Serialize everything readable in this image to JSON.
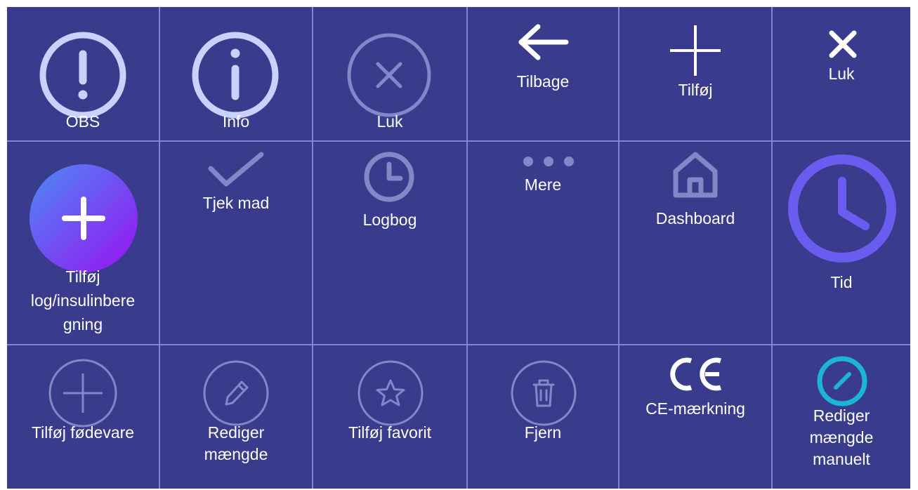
{
  "icons": [
    {
      "label": "OBS",
      "icon": "alert-circle-icon"
    },
    {
      "label": "Info",
      "icon": "info-circle-icon"
    },
    {
      "label": "Luk",
      "icon": "close-circle-icon"
    },
    {
      "label": "Tilbage",
      "icon": "arrow-left-icon"
    },
    {
      "label": "Tilføj",
      "icon": "plus-icon"
    },
    {
      "label": "Luk",
      "icon": "close-icon"
    },
    {
      "label": "Tilføj log/insulinberegning",
      "label_lines": [
        "Tilføj",
        "log/insulinbere",
        "gning"
      ],
      "icon": "add-log-gradient-icon"
    },
    {
      "label": "Tjek mad",
      "icon": "check-icon"
    },
    {
      "label": "Logbog",
      "icon": "clock-icon"
    },
    {
      "label": "Mere",
      "icon": "more-dots-icon"
    },
    {
      "label": "Dashboard",
      "icon": "home-icon"
    },
    {
      "label": "Tid",
      "icon": "time-clock-icon"
    },
    {
      "label": "Tilføj fødevare",
      "icon": "add-circle-outline-icon"
    },
    {
      "label": "Rediger mængde",
      "label_lines": [
        "Rediger",
        "mængde"
      ],
      "icon": "edit-circle-icon"
    },
    {
      "label": "Tilføj favorit",
      "icon": "star-circle-icon"
    },
    {
      "label": "Fjern",
      "icon": "trash-circle-icon"
    },
    {
      "label": "CE-mærkning",
      "icon": "ce-mark-icon"
    },
    {
      "label": "Rediger mængde manuelt",
      "label_lines": [
        "Rediger",
        "mængde",
        "manuelt"
      ],
      "icon": "edit-manual-icon"
    }
  ],
  "colors": {
    "background": "#393c8d",
    "grid_line": "#7f85d4",
    "icon_light": "#c8d2ff",
    "icon_muted": "#8088c8",
    "accent_purple": "#6b5cf0",
    "accent_teal": "#1cb5d9",
    "gradient_start": "#4a8cf5",
    "gradient_end": "#9a10f0"
  }
}
